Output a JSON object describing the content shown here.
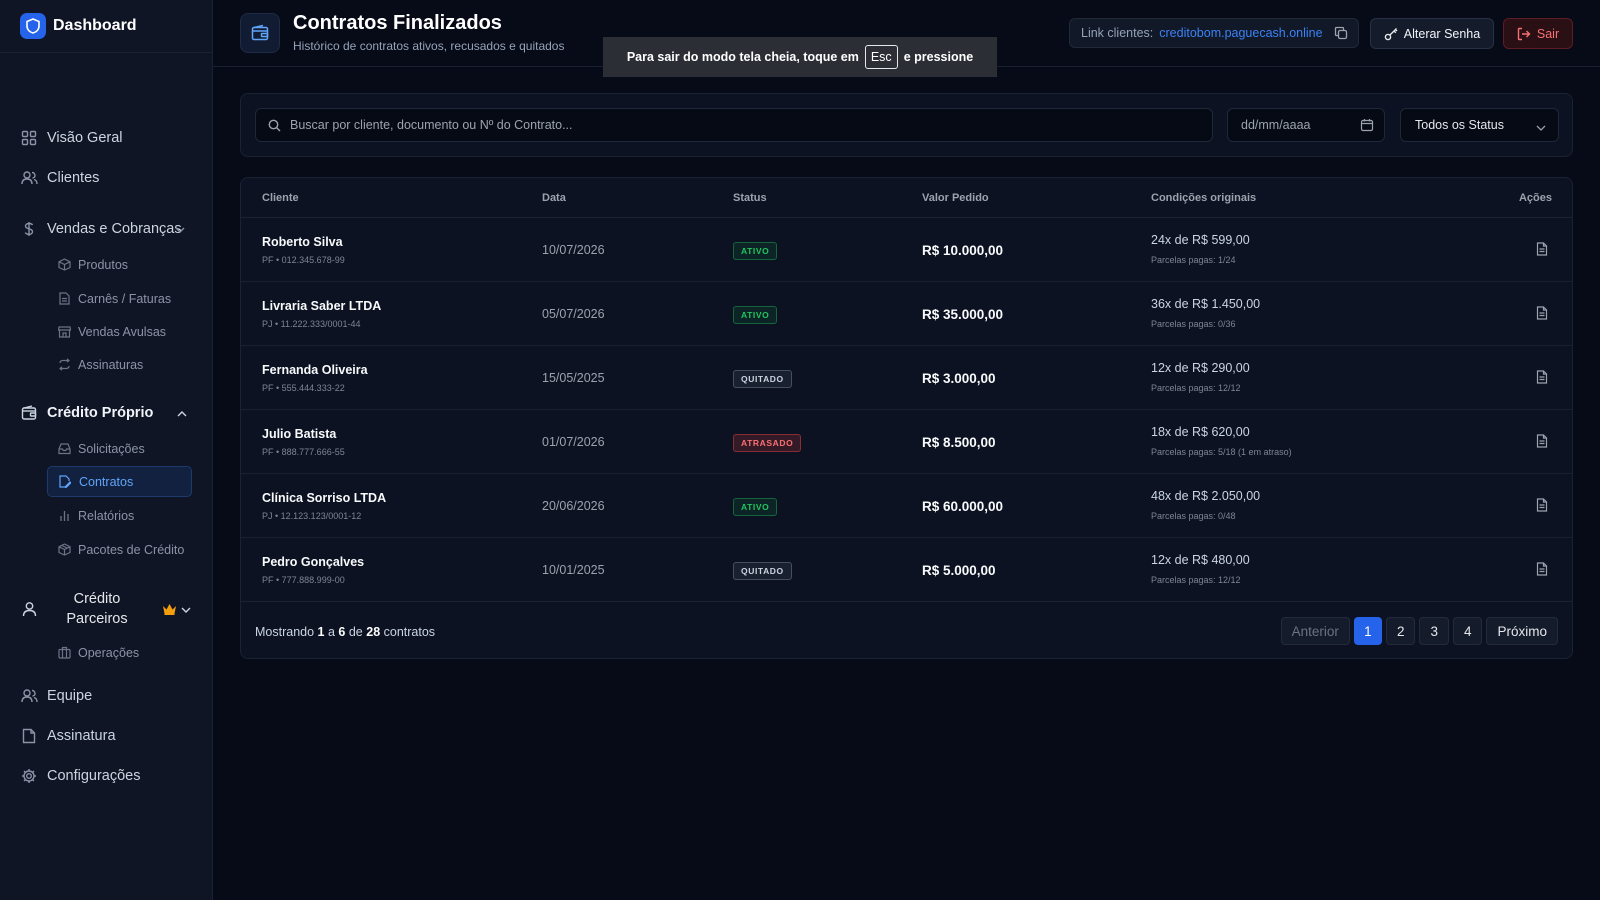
{
  "sidebar": {
    "brand": "Dashboard",
    "items": {
      "overview": "Visão Geral",
      "clients": "Clientes",
      "sales": "Vendas e Cobranças",
      "products": "Produtos",
      "invoices": "Carnês / Faturas",
      "single_sales": "Vendas Avulsas",
      "subscriptions_sub": "Assinaturas",
      "own_credit": "Crédito Próprio",
      "requests": "Solicitações",
      "contracts": "Contratos",
      "reports": "Relatórios",
      "credit_packages": "Pacotes de Crédito",
      "partner_credit_1": "Crédito",
      "partner_credit_2": "Parceiros",
      "operations": "Operações",
      "team": "Equipe",
      "subscription": "Assinatura",
      "settings": "Configurações"
    }
  },
  "header": {
    "title": "Contratos Finalizados",
    "subtitle": "Histórico de contratos ativos, recusados e quitados",
    "link_label": "Link clientes:",
    "link_url": "creditobom.paguecash.online",
    "change_password": "Alterar Senha",
    "logout": "Sair"
  },
  "toast": {
    "before": "Para sair do modo tela cheia, toque em",
    "key": "Esc",
    "after": "e pressione"
  },
  "filters": {
    "search_placeholder": "Buscar por cliente, documento ou Nº do Contrato...",
    "date_placeholder": "dd/mm/aaaa",
    "status_selected": "Todos os Status"
  },
  "table": {
    "headers": {
      "client": "Cliente",
      "date": "Data",
      "status": "Status",
      "value": "Valor Pedido",
      "conditions": "Condições originais",
      "actions": "Ações"
    },
    "rows": [
      {
        "name": "Roberto Silva",
        "doc": "PF • 012.345.678-99",
        "date": "10/07/2026",
        "status": "ATIVO",
        "value": "R$ 10.000,00",
        "cond": "24x de R$ 599,00",
        "paid": "Parcelas pagas: 1/24"
      },
      {
        "name": "Livraria Saber LTDA",
        "doc": "PJ • 11.222.333/0001-44",
        "date": "05/07/2026",
        "status": "ATIVO",
        "value": "R$ 35.000,00",
        "cond": "36x de R$ 1.450,00",
        "paid": "Parcelas pagas: 0/36"
      },
      {
        "name": "Fernanda Oliveira",
        "doc": "PF • 555.444.333-22",
        "date": "15/05/2025",
        "status": "QUITADO",
        "value": "R$ 3.000,00",
        "cond": "12x de R$ 290,00",
        "paid": "Parcelas pagas: 12/12"
      },
      {
        "name": "Julio Batista",
        "doc": "PF • 888.777.666-55",
        "date": "01/07/2026",
        "status": "ATRASADO",
        "value": "R$ 8.500,00",
        "cond": "18x de R$ 620,00",
        "paid": "Parcelas pagas: 5/18 (1 em atraso)"
      },
      {
        "name": "Clínica Sorriso LTDA",
        "doc": "PJ • 12.123.123/0001-12",
        "date": "20/06/2026",
        "status": "ATIVO",
        "value": "R$ 60.000,00",
        "cond": "48x de R$ 2.050,00",
        "paid": "Parcelas pagas: 0/48"
      },
      {
        "name": "Pedro Gonçalves",
        "doc": "PF • 777.888.999-00",
        "date": "10/01/2025",
        "status": "QUITADO",
        "value": "R$ 5.000,00",
        "cond": "12x de R$ 480,00",
        "paid": "Parcelas pagas: 12/12"
      }
    ]
  },
  "footer": {
    "showing": "Mostrando",
    "from": "1",
    "a": "a",
    "to": "6",
    "de": "de",
    "total": "28",
    "unit": "contratos",
    "prev": "Anterior",
    "pages": [
      "1",
      "2",
      "3",
      "4"
    ],
    "next": "Próximo"
  },
  "colors": {
    "accent": "#2563eb",
    "status_active": "#22c55e",
    "status_paid": "#9ca3af",
    "status_late": "#ef4444"
  }
}
